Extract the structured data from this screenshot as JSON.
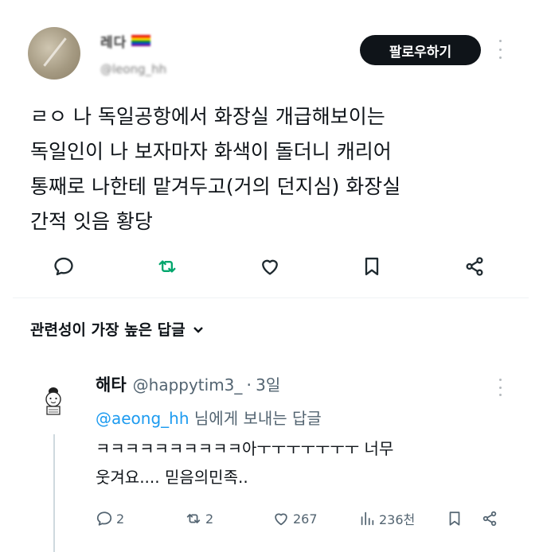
{
  "author": {
    "name": "레다",
    "handle": "@leong_hh",
    "follow_label": "팔로우하기"
  },
  "post": {
    "lines": [
      "ㄹㅇ 나 독일공항에서 화장실 개급해보이는",
      "독일인이 나 보자마자 화색이 돌더니 캐리어",
      "통째로 나한테 맡겨두고(거의 던지심) 화장실",
      "간적 잇음 황당"
    ]
  },
  "actions": [
    "reply-icon",
    "retweet-icon",
    "like-icon",
    "bookmark-icon",
    "share-icon"
  ],
  "replies_header": "관련성이 가장 높은 답글",
  "reply": {
    "name": "해타",
    "handle": "@happytim3_",
    "dot": "·",
    "time": "3일",
    "reply_to_mention": "@aeong_hh",
    "reply_to_text": " 님에게 보내는 답글",
    "body_lines": [
      "ㅋㅋㅋㅋㅋㅋㅋㅋㅋㅋ아ㅜㅜㅜㅜㅜㅜㅜ 너무",
      "웃겨요.... 믿음의민족.."
    ],
    "stats": {
      "replies": "2",
      "retweets": "2",
      "likes": "267",
      "views": "236천"
    }
  },
  "colors": {
    "text": "#0f1419",
    "secondary": "#536471",
    "link": "#1d9bf0",
    "retweet_green": "#00a66c",
    "button_dark": "#0f1419"
  }
}
